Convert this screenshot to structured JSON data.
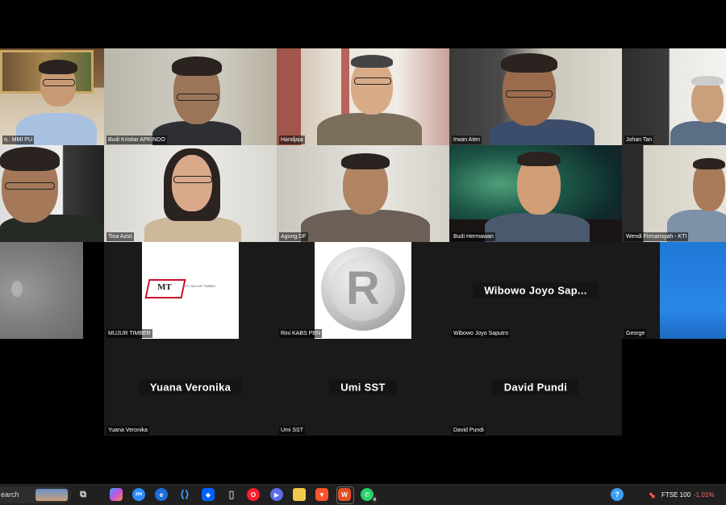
{
  "participants_row1": [
    {
      "name": "o.. MMI PU"
    },
    {
      "name": "Budi Kristiar APKINDO"
    },
    {
      "name": "Handjaja"
    },
    {
      "name": "Irwan Aten"
    },
    {
      "name": "Johan Tan"
    }
  ],
  "participants_row2": [
    {
      "name": ""
    },
    {
      "name": "Tina Azizi"
    },
    {
      "name": "Agung DF"
    },
    {
      "name": "Budi Hermawan"
    },
    {
      "name": "Wendi Firmansyah - KTI"
    }
  ],
  "participants_row3": [
    {
      "name": ""
    },
    {
      "name": "MUJUR TIMBER",
      "logo_text": "MT",
      "logo_sub": "PT. MUJUR TIMBER"
    },
    {
      "name": "Rini KABS PBN",
      "logo_text": "R"
    },
    {
      "name": "Wibowo Joyo Saputro",
      "display": "Wibowo Joyo Sap..."
    },
    {
      "name": "George"
    }
  ],
  "participants_row4": [
    {
      "name": "Yuana Veronika",
      "display": "Yuana Veronika"
    },
    {
      "name": "Umi SST",
      "display": "Umi SST"
    },
    {
      "name": "David Pundi",
      "display": "David Pundi"
    }
  ],
  "taskbar": {
    "search_text": "earch",
    "ticker_name": "FTSE 100",
    "ticker_change": "-1.01%",
    "whatsapp_badge": "4"
  },
  "colors": {
    "background": "#000000",
    "tile_dark": "#1a1a1a",
    "taskbar": "#202020",
    "negative": "#ff6b6b"
  }
}
